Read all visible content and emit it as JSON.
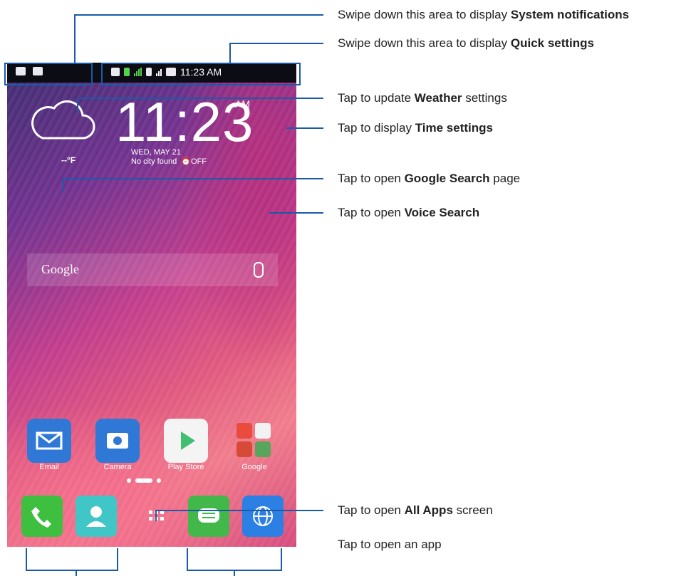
{
  "status": {
    "time": "11:23 AM"
  },
  "widget": {
    "time": "11:23",
    "ampm": "AM",
    "temp": "--°F",
    "date_line": "WED, MAY 21",
    "city_line": "No city found",
    "off_label": "OFF"
  },
  "search": {
    "label": "Google"
  },
  "apps": [
    {
      "label": "Email"
    },
    {
      "label": "Camera"
    },
    {
      "label": "Play Store"
    },
    {
      "label": "Google"
    }
  ],
  "callouts": {
    "system_notifications": {
      "prefix": "Swipe down this area to display ",
      "bold": "System notifications",
      "suffix": ""
    },
    "quick_settings": {
      "prefix": "Swipe down this area to display ",
      "bold": "Quick settings",
      "suffix": ""
    },
    "weather": {
      "prefix": "Tap to update ",
      "bold": "Weather",
      "suffix": " settings"
    },
    "time": {
      "prefix": "Tap to display ",
      "bold": "Time settings",
      "suffix": ""
    },
    "google_search": {
      "prefix": "Tap to open ",
      "bold": "Google Search",
      "suffix": " page"
    },
    "voice_search": {
      "prefix": "Tap to open ",
      "bold": "Voice Search",
      "suffix": ""
    },
    "all_apps": {
      "prefix": "Tap to open ",
      "bold": "All Apps",
      "suffix": " screen"
    },
    "open_app": {
      "prefix": "Tap to open an app",
      "bold": "",
      "suffix": ""
    }
  },
  "colors": {
    "accent": "#1a5aa8",
    "email": "#2f78d6",
    "camera": "#2f78d6",
    "phone": "#3fbf3f",
    "contacts": "#41c6c8",
    "messages": "#42b84a",
    "browser": "#2c7fe3"
  }
}
